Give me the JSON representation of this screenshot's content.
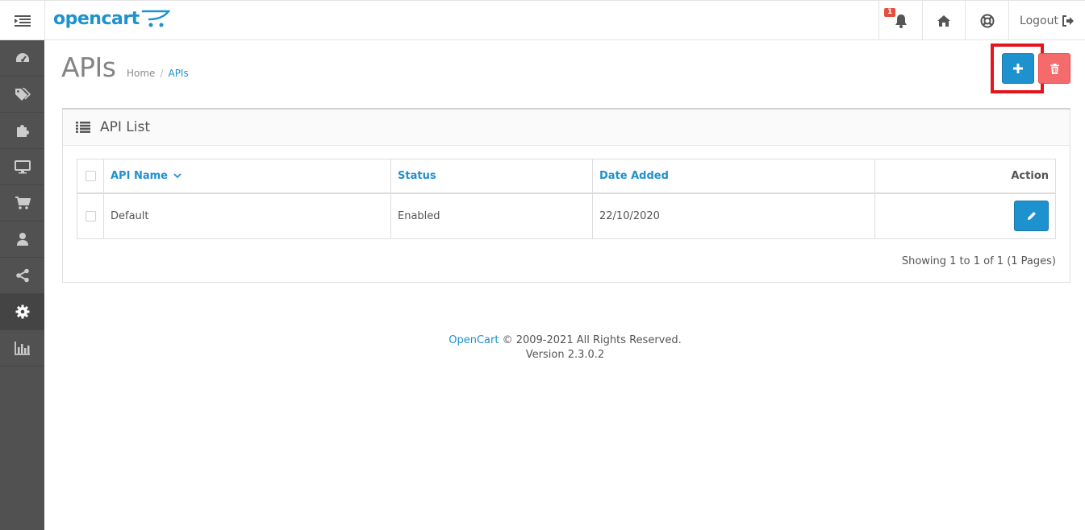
{
  "header": {
    "logo_text": "opencart",
    "notification_count": "1",
    "logout_label": "Logout"
  },
  "page": {
    "title": "APIs",
    "breadcrumb": [
      "Home",
      "APIs"
    ],
    "breadcrumb_sep": "/"
  },
  "panel": {
    "title": "API List",
    "columns": {
      "name": "API Name",
      "status": "Status",
      "date": "Date Added",
      "action": "Action"
    },
    "rows": [
      {
        "name": "Default",
        "status": "Enabled",
        "date": "22/10/2020"
      }
    ],
    "pagination": "Showing 1 to 1 of 1 (1 Pages)"
  },
  "footer": {
    "brand": "OpenCart",
    "rights": "© 2009-2021 All Rights Reserved.",
    "version": "Version 2.3.0.2"
  },
  "colors": {
    "primary": "#1e91cf",
    "danger": "#f56b6b",
    "sidebar": "#515151",
    "highlight": "#e4161d"
  },
  "icons": {
    "menu": "menu-toggle-icon",
    "bell": "bell-icon",
    "home": "home-icon",
    "help": "life-ring-icon",
    "logout": "sign-out-icon",
    "sidebar": [
      "dashboard-icon",
      "tags-icon",
      "puzzle-icon",
      "desktop-icon",
      "cart-icon",
      "user-icon",
      "share-icon",
      "cog-icon",
      "bar-chart-icon"
    ]
  }
}
